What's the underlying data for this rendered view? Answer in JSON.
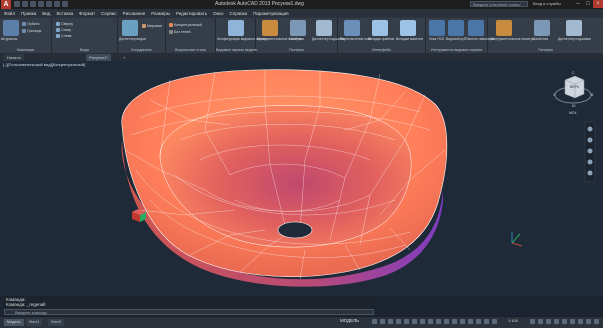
{
  "title_bar": {
    "app_menu_letter": "A",
    "title": "Autodesk AutoCAD 2013   Рисунок1.dwg",
    "search_placeholder": "Введите ключевое слово/фразу",
    "signin": "Вход в службы"
  },
  "menu_bar": {
    "items": [
      "Файл",
      "Правка",
      "Вид",
      "Вставка",
      "Формат",
      "Сервис",
      "Рисование",
      "Размеры",
      "Редактировать",
      "Окно",
      "Справка",
      "Параметризация"
    ],
    "tabs": [
      "Главная",
      "Тело",
      "Поверхность",
      "Сеть",
      "Визуализация",
      "Параметризация",
      "Вставка",
      "Аннотации",
      "Вид",
      "Управление",
      "Вывод",
      "Надстройки",
      "Autodesk 360",
      "BIM 360",
      "Рекомендованные приложения",
      "Express Tools"
    ],
    "active_tab": "Вид"
  },
  "ribbon": {
    "panels": [
      {
        "title": "Навигация",
        "buttons": [
          "Штурвалы",
          "Орбита",
          "Границы"
        ]
      },
      {
        "title": "Виды",
        "buttons": [
          "Сверху",
          "Снизу",
          "Слева"
        ]
      },
      {
        "title": "Координаты",
        "buttons": [
          "Диспетчер видов",
          "Мировая"
        ]
      },
      {
        "title": "Визуальные стили",
        "buttons": [
          "Концептуальный",
          "Без теней"
        ]
      },
      {
        "title": "Видовые экраны модели",
        "buttons": [
          "Конфигурация видового экрана"
        ]
      },
      {
        "title": "Палитры",
        "buttons": [
          "Инструментальные палитры",
          "Свойства",
          "Диспетчер подшивок"
        ]
      },
      {
        "title": "Интерфейс",
        "buttons": [
          "Переключение окон",
          "Вкладки файлов",
          "Вкладки макетов"
        ]
      },
      {
        "title": "Инструменты видового экрана",
        "buttons": [
          "Знак ПСК",
          "Видовой куб",
          "Панель навигации"
        ]
      },
      {
        "title": "Палитры",
        "buttons": [
          "Инструментальные палитры",
          "Свойства",
          "Диспетчер подшивок"
        ]
      }
    ]
  },
  "file_tabs": {
    "start": "Начало",
    "tabs": [
      "Рисунок1*"
    ],
    "add": "+"
  },
  "viewport": {
    "label": "[–][Пользовательский вид][Концептуальный]",
    "viewcube_face": "ВЕРХ",
    "compass": [
      "С",
      "В",
      "Ю",
      "З"
    ],
    "wcs_label": "МСК"
  },
  "command": {
    "history": [
      "Команда:",
      "Команда: _regenall"
    ],
    "input_placeholder": "Введите команду"
  },
  "status_bar": {
    "layout_tabs": [
      "Модель",
      "Лист1",
      "Лист2"
    ],
    "mode": "МОДЕЛЬ",
    "scale": "1:100"
  },
  "colors": {
    "accent": "#b03a2e",
    "mesh_light": "#ff9a6a",
    "mesh_dark": "#7f3cc4",
    "background": "#1f2a38"
  }
}
